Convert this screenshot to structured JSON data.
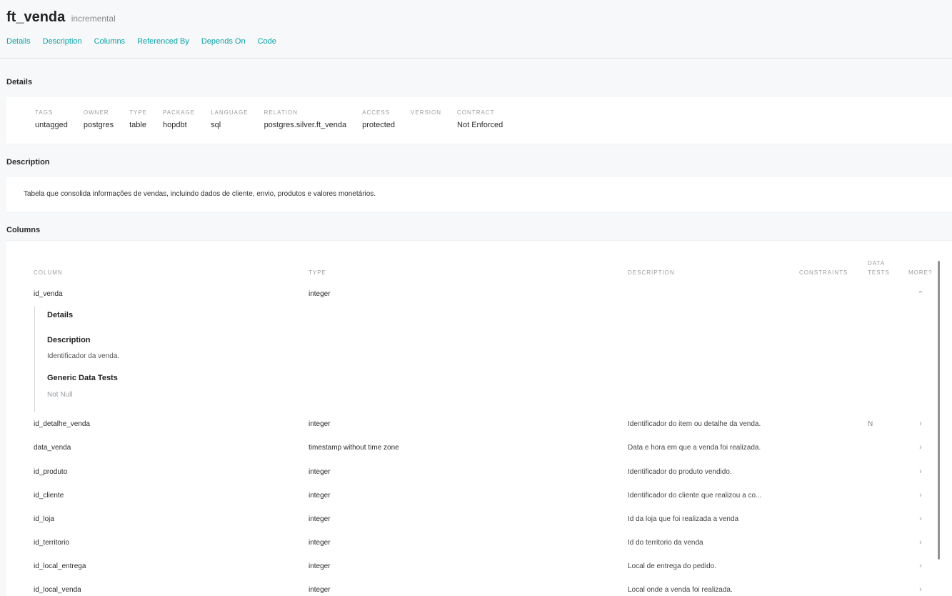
{
  "header": {
    "title": "ft_venda",
    "badge": "incremental"
  },
  "tabs": [
    "Details",
    "Description",
    "Columns",
    "Referenced By",
    "Depends On",
    "Code"
  ],
  "sections": {
    "details": "Details",
    "description": "Description",
    "columns": "Columns"
  },
  "details": [
    {
      "label": "TAGS",
      "value": "untagged"
    },
    {
      "label": "OWNER",
      "value": "postgres"
    },
    {
      "label": "TYPE",
      "value": "table"
    },
    {
      "label": "PACKAGE",
      "value": "hopdbt"
    },
    {
      "label": "LANGUAGE",
      "value": "sql"
    },
    {
      "label": "RELATION",
      "value": "postgres.silver.ft_venda"
    },
    {
      "label": "ACCESS",
      "value": "protected"
    },
    {
      "label": "VERSION",
      "value": ""
    },
    {
      "label": "CONTRACT",
      "value": "Not Enforced"
    }
  ],
  "description": "Tabela que consolida informações de vendas, incluindo dados de cliente, envio, produtos e valores monetários.",
  "columns_table": {
    "headers": {
      "column": "COLUMN",
      "type": "TYPE",
      "description": "DESCRIPTION",
      "constraints": "CONSTRAINTS",
      "data_tests_1": "DATA",
      "data_tests_2": "TESTS",
      "more": "MORE?"
    },
    "expanded": {
      "name": "id_venda",
      "type": "integer",
      "details_heading": "Details",
      "description_heading": "Description",
      "description": "Identificador da venda.",
      "tests_heading": "Generic Data Tests",
      "tests": "Not Null",
      "chevron": "⌃"
    },
    "rows": [
      {
        "name": "id_detalhe_venda",
        "type": "integer",
        "description": "Identificador do item ou detalhe da venda.",
        "data_tests": "N",
        "chevron": "›"
      },
      {
        "name": "data_venda",
        "type": "timestamp without time zone",
        "description": "Data e hora em que a venda foi realizada.",
        "data_tests": "",
        "chevron": "›"
      },
      {
        "name": "id_produto",
        "type": "integer",
        "description": "Identificador do produto vendido.",
        "data_tests": "",
        "chevron": "›"
      },
      {
        "name": "id_cliente",
        "type": "integer",
        "description": "Identificador do cliente que realizou a co...",
        "data_tests": "",
        "chevron": "›"
      },
      {
        "name": "id_loja",
        "type": "integer",
        "description": "Id da loja que foi realizada a venda",
        "data_tests": "",
        "chevron": "›"
      },
      {
        "name": "id_territorio",
        "type": "integer",
        "description": "Id do territorio da venda",
        "data_tests": "",
        "chevron": "›"
      },
      {
        "name": "id_local_entrega",
        "type": "integer",
        "description": "Local de entrega do pedido.",
        "data_tests": "",
        "chevron": "›"
      },
      {
        "name": "id_local_venda",
        "type": "integer",
        "description": "Local onde a venda foi realizada.",
        "data_tests": "",
        "chevron": "›"
      }
    ]
  }
}
